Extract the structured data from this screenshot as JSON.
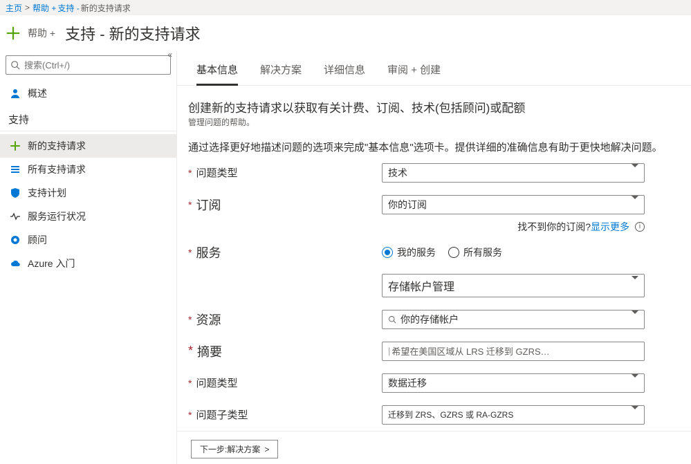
{
  "breadcrumb": {
    "home": "主页",
    "help": "帮助 +",
    "support": "支持 -",
    "current": "新的支持请求"
  },
  "title": {
    "prefix": "帮助 +",
    "main": "支持 - 新的支持请求"
  },
  "sidebar": {
    "search_placeholder": "搜索(Ctrl+/)",
    "overview": "概述",
    "section": "支持",
    "items": {
      "new_request": "新的支持请求",
      "all_requests": "所有支持请求",
      "support_plan": "支持计划",
      "service_health": "服务运行状况",
      "advisor": "顾问",
      "azure_intro": "Azure 入门"
    }
  },
  "tabs": {
    "basics": "基本信息",
    "solutions": "解决方案",
    "details": "详细信息",
    "review": "审阅 + 创建"
  },
  "intro": {
    "line1a": "创建新的支持请求以获取有关计费、订阅、技术(包括顾问)或配额",
    "line1b": "管理问题的帮助。",
    "line2": "通过选择更好地描述问题的选项来完成\"基本信息\"选项卡。提供详细的准确信息有助于更快地解决问题。"
  },
  "form": {
    "issue_type": {
      "label": "问题类型",
      "value": "技术"
    },
    "subscription": {
      "label": "订阅",
      "value": "你的订阅",
      "helper_text": "找不到你的订阅?",
      "helper_link": "显示更多"
    },
    "service": {
      "label": "服务",
      "radio_my": "我的服务",
      "radio_all": "所有服务",
      "selected": "my",
      "value": "存储帐户管理"
    },
    "resource": {
      "label": "资源",
      "value": "你的存储帐户"
    },
    "summary": {
      "label": "摘要",
      "value": "希望在美国区域从 LRS 迁移到 GZRS…"
    },
    "problem_type": {
      "label": "问题类型",
      "value": "数据迁移"
    },
    "problem_subtype": {
      "label": "问题子类型",
      "value": "迁移到 ZRS、GZRS 或 RA-GZRS"
    }
  },
  "footer": {
    "next": "下一步:解决方案"
  }
}
